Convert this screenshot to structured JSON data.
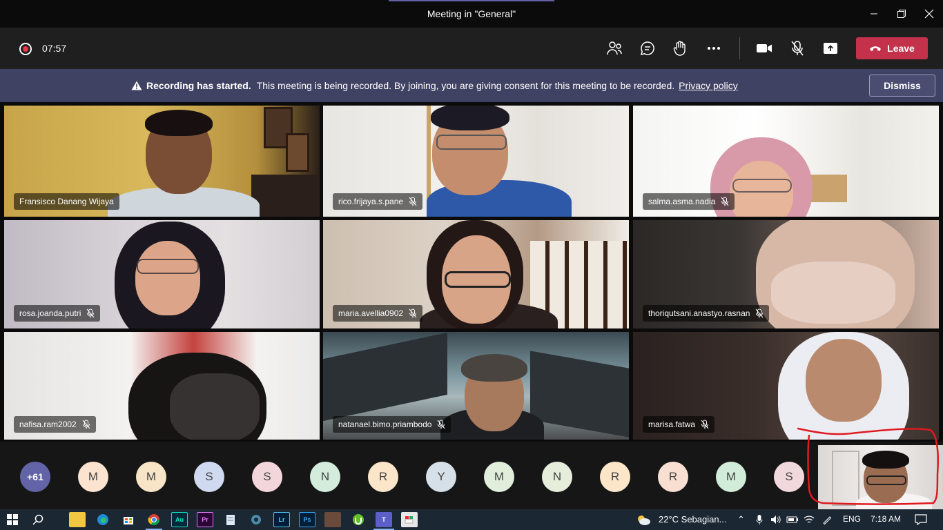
{
  "window": {
    "title": "Meeting in \"General\""
  },
  "toolbar": {
    "timer": "07:57",
    "leave_label": "Leave"
  },
  "banner": {
    "bold": "Recording has started.",
    "text": "This meeting is being recorded. By joining, you are giving consent for this meeting to be recorded.",
    "link": "Privacy policy",
    "dismiss_label": "Dismiss"
  },
  "tiles": [
    {
      "name": "Fransisco Danang Wijaya",
      "muted": false
    },
    {
      "name": "rico.frijaya.s.pane",
      "muted": true
    },
    {
      "name": "salma.asma.nadia",
      "muted": true
    },
    {
      "name": "rosa.joanda.putri",
      "muted": true
    },
    {
      "name": "maria.avellia0902",
      "muted": true
    },
    {
      "name": "thoriqutsani.anastyo.rasnan",
      "muted": true
    },
    {
      "name": "nafisa.ram2002",
      "muted": true
    },
    {
      "name": "natanael.bimo.priambodo",
      "muted": true
    },
    {
      "name": "marisa.fatwa",
      "muted": true
    }
  ],
  "strip": {
    "overflow": "+61",
    "avatars": [
      {
        "initial": "M",
        "color": "#fbe3cf"
      },
      {
        "initial": "M",
        "color": "#f8e5c8"
      },
      {
        "initial": "S",
        "color": "#cfd9ef"
      },
      {
        "initial": "S",
        "color": "#f3d6dc"
      },
      {
        "initial": "N",
        "color": "#d3ecdc"
      },
      {
        "initial": "R",
        "color": "#fbe6c9"
      },
      {
        "initial": "Y",
        "color": "#d6e0e8"
      },
      {
        "initial": "M",
        "color": "#e0eedb"
      },
      {
        "initial": "N",
        "color": "#e6eedb"
      },
      {
        "initial": "R",
        "color": "#fbe6c9"
      },
      {
        "initial": "R",
        "color": "#f8dfd1"
      },
      {
        "initial": "M",
        "color": "#d1ecd9"
      },
      {
        "initial": "S",
        "color": "#f0d8dd"
      }
    ]
  },
  "taskbar": {
    "apps": [
      "Au",
      "Pr",
      "Lr",
      "Ps"
    ],
    "weather": "22°C  Sebagian...",
    "lang": "ENG",
    "time": "7:18 AM"
  },
  "colors": {
    "leave": "#c4314b",
    "banner": "#404263",
    "accent": "#6264a7",
    "annotation": "#e0191f"
  }
}
